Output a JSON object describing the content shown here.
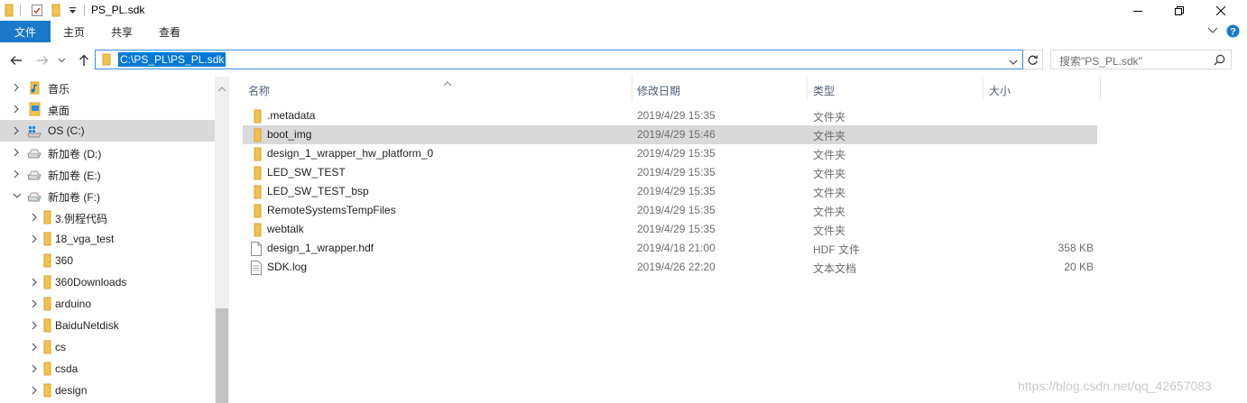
{
  "window": {
    "title": "PS_PL.sdk"
  },
  "ribbon": {
    "tabs": [
      "文件",
      "主页",
      "共享",
      "查看"
    ]
  },
  "address": {
    "path": "C:\\PS_PL\\PS_PL.sdk",
    "search_placeholder": "搜索\"PS_PL.sdk\""
  },
  "nav": {
    "items": [
      {
        "label": "音乐",
        "icon": "music-icon",
        "level": 1,
        "chevron": "collapsed",
        "selected": false
      },
      {
        "label": "桌面",
        "icon": "desktop-folder-icon",
        "level": 1,
        "chevron": "collapsed",
        "selected": false
      },
      {
        "label": "OS (C:)",
        "icon": "windows-drive-icon",
        "level": 1,
        "chevron": "collapsed",
        "selected": true
      },
      {
        "label": "新加卷 (D:)",
        "icon": "drive-icon",
        "level": 1,
        "chevron": "collapsed",
        "selected": false
      },
      {
        "label": "新加卷 (E:)",
        "icon": "drive-icon",
        "level": 1,
        "chevron": "collapsed",
        "selected": false
      },
      {
        "label": "新加卷 (F:)",
        "icon": "drive-icon",
        "level": 1,
        "chevron": "expanded",
        "selected": false
      },
      {
        "label": "3.例程代码",
        "icon": "folder-icon",
        "level": 2,
        "chevron": "collapsed",
        "selected": false
      },
      {
        "label": "18_vga_test",
        "icon": "folder-icon",
        "level": 2,
        "chevron": "collapsed",
        "selected": false
      },
      {
        "label": "360",
        "icon": "folder-icon",
        "level": 2,
        "chevron": "none",
        "selected": false
      },
      {
        "label": "360Downloads",
        "icon": "folder-icon",
        "level": 2,
        "chevron": "collapsed",
        "selected": false
      },
      {
        "label": "arduino",
        "icon": "folder-icon",
        "level": 2,
        "chevron": "collapsed",
        "selected": false
      },
      {
        "label": "BaiduNetdisk",
        "icon": "folder-icon",
        "level": 2,
        "chevron": "collapsed",
        "selected": false
      },
      {
        "label": "cs",
        "icon": "folder-icon",
        "level": 2,
        "chevron": "collapsed",
        "selected": false
      },
      {
        "label": "csda",
        "icon": "folder-icon",
        "level": 2,
        "chevron": "collapsed",
        "selected": false
      },
      {
        "label": "design",
        "icon": "folder-icon",
        "level": 2,
        "chevron": "collapsed",
        "selected": false
      }
    ]
  },
  "columns": {
    "name": "名称",
    "date": "修改日期",
    "type": "类型",
    "size": "大小"
  },
  "files": [
    {
      "name": ".metadata",
      "date": "2019/4/29 15:35",
      "type": "文件夹",
      "size": "",
      "icon": "folder-icon",
      "highlighted": false
    },
    {
      "name": "boot_img",
      "date": "2019/4/29 15:46",
      "type": "文件夹",
      "size": "",
      "icon": "folder-icon",
      "highlighted": true
    },
    {
      "name": "design_1_wrapper_hw_platform_0",
      "date": "2019/4/29 15:35",
      "type": "文件夹",
      "size": "",
      "icon": "folder-icon",
      "highlighted": false
    },
    {
      "name": "LED_SW_TEST",
      "date": "2019/4/29 15:35",
      "type": "文件夹",
      "size": "",
      "icon": "folder-icon",
      "highlighted": false
    },
    {
      "name": "LED_SW_TEST_bsp",
      "date": "2019/4/29 15:35",
      "type": "文件夹",
      "size": "",
      "icon": "folder-icon",
      "highlighted": false
    },
    {
      "name": "RemoteSystemsTempFiles",
      "date": "2019/4/29 15:35",
      "type": "文件夹",
      "size": "",
      "icon": "folder-icon",
      "highlighted": false
    },
    {
      "name": "webtalk",
      "date": "2019/4/29 15:35",
      "type": "文件夹",
      "size": "",
      "icon": "folder-icon",
      "highlighted": false
    },
    {
      "name": "design_1_wrapper.hdf",
      "date": "2019/4/18 21:00",
      "type": "HDF 文件",
      "size": "358 KB",
      "icon": "file-icon",
      "highlighted": false
    },
    {
      "name": "SDK.log",
      "date": "2019/4/26 22:20",
      "type": "文本文档",
      "size": "20 KB",
      "icon": "text-file-icon",
      "highlighted": false
    }
  ],
  "watermark": "https://blog.csdn.net/qq_42657083",
  "colors": {
    "accent": "#0078d7",
    "file_tab": "#1979ca",
    "selection": "#d9d9d9",
    "folder_yellow": "#f2c14e"
  }
}
